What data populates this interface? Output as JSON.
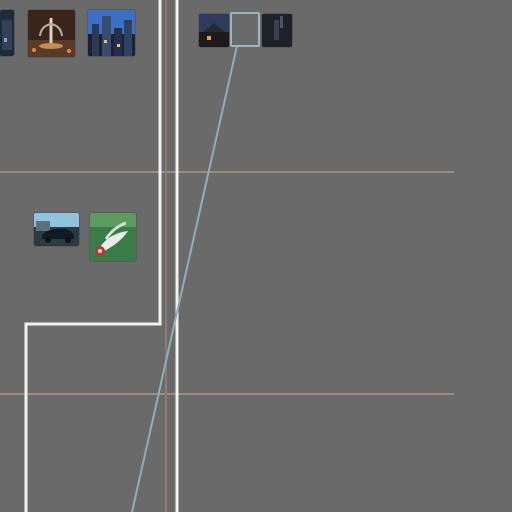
{
  "canvas": {
    "background_color": "#6a6a6a",
    "guide_color": "#9a8a82",
    "region_border_color": "#f2f2f2",
    "connector_color": "#8fb0b8"
  },
  "groups": {
    "upper_left": {
      "thumbnails": [
        {
          "name": "thumb-night-building-partial"
        },
        {
          "name": "thumb-fountain-night"
        },
        {
          "name": "thumb-city-skyline-blue"
        }
      ]
    },
    "upper_right": {
      "thumbnails": [
        {
          "name": "thumb-dusk-house"
        },
        {
          "name": "thumb-empty-slot"
        },
        {
          "name": "thumb-dark-figure"
        }
      ]
    },
    "middle_left": {
      "thumbnails": [
        {
          "name": "thumb-car-street"
        },
        {
          "name": "thumb-green-plant"
        }
      ]
    }
  }
}
